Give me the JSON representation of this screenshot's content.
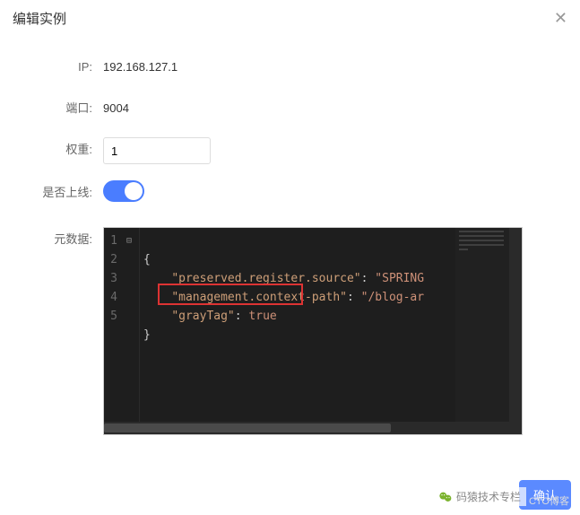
{
  "dialog": {
    "title": "编辑实例"
  },
  "fields": {
    "ip": {
      "label": "IP:",
      "value": "192.168.127.1"
    },
    "port": {
      "label": "端口:",
      "value": "9004"
    },
    "weight": {
      "label": "权重:",
      "value": "1"
    },
    "online": {
      "label": "是否上线:",
      "on": true
    },
    "metadata": {
      "label": "元数据:"
    }
  },
  "editor": {
    "lines": [
      "1",
      "2",
      "3",
      "4",
      "5"
    ],
    "content": {
      "l1_brace": "{",
      "l2_key": "\"preserved.register.source\"",
      "l2_sep": ": ",
      "l2_val": "\"SPRING",
      "l3_key": "\"management.context-path\"",
      "l3_sep": ": ",
      "l3_val": "\"/blog-ar",
      "l4_key": "\"grayTag\"",
      "l4_sep": ": ",
      "l4_val": "true",
      "l5_brace": "}"
    }
  },
  "footer": {
    "confirm": "确认"
  },
  "watermark": {
    "channel": "码猿技术专栏",
    "stamp": "CTO博客"
  }
}
